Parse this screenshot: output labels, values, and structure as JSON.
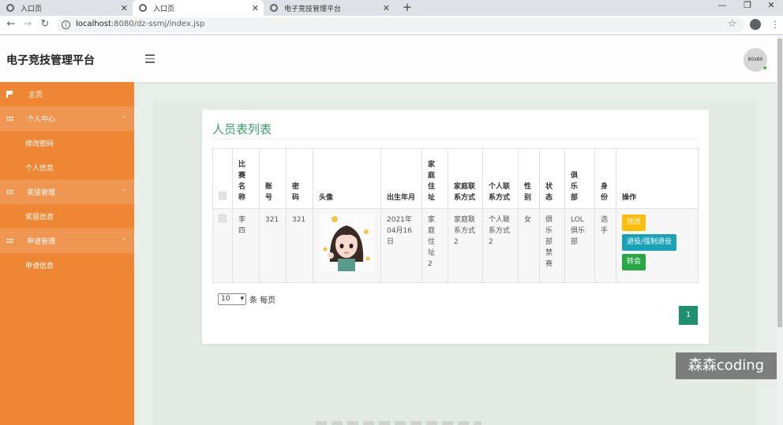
{
  "browser": {
    "tabs": [
      {
        "label": "入口页",
        "active": false
      },
      {
        "label": "入口页",
        "active": true
      },
      {
        "label": "电子竞技管理平台",
        "active": false
      }
    ],
    "new_tab_symbol": "+",
    "url_host": "localhost",
    "url_rest": ":8080/dz-ssmj/index.jsp"
  },
  "app": {
    "title": "电子竞技管理平台",
    "avatar_text": "80x80"
  },
  "sidebar": {
    "home": "主页",
    "groups": [
      {
        "label": "个人中心",
        "items": [
          "修改密码",
          "个人信息"
        ]
      },
      {
        "label": "奖惩管理",
        "items": [
          "奖惩信息"
        ]
      },
      {
        "label": "申请管理",
        "items": [
          "申请信息"
        ]
      }
    ]
  },
  "main": {
    "card_title": "人员表列表",
    "columns": [
      "比赛名称",
      "账号",
      "密码",
      "头像",
      "出生年月",
      "家庭住址",
      "家庭联系方式",
      "个人联系方式",
      "性别",
      "状态",
      "俱乐部",
      "身份",
      "操作"
    ],
    "rows": [
      {
        "name": "李四",
        "account": "321",
        "password": "321",
        "birth": "2021年04月16日",
        "address": "家庭住址2",
        "family_contact": "家庭联系方式2",
        "personal_contact": "个人联系方式2",
        "gender": "女",
        "status": "俱乐部禁赛",
        "club": "LOL俱乐部",
        "role": "选手",
        "actions": {
          "edit": "修改",
          "quit": "退役/强制退役",
          "transfer": "转会"
        }
      }
    ],
    "pager": {
      "page_size": "10",
      "per_page_label": "条 每页",
      "current_page": "1"
    }
  },
  "overlay": {
    "watermark": "森森coding"
  },
  "colors": {
    "sidebar": "#ed8733",
    "accent_green": "#35a368",
    "page_button": "#1f8f70"
  }
}
